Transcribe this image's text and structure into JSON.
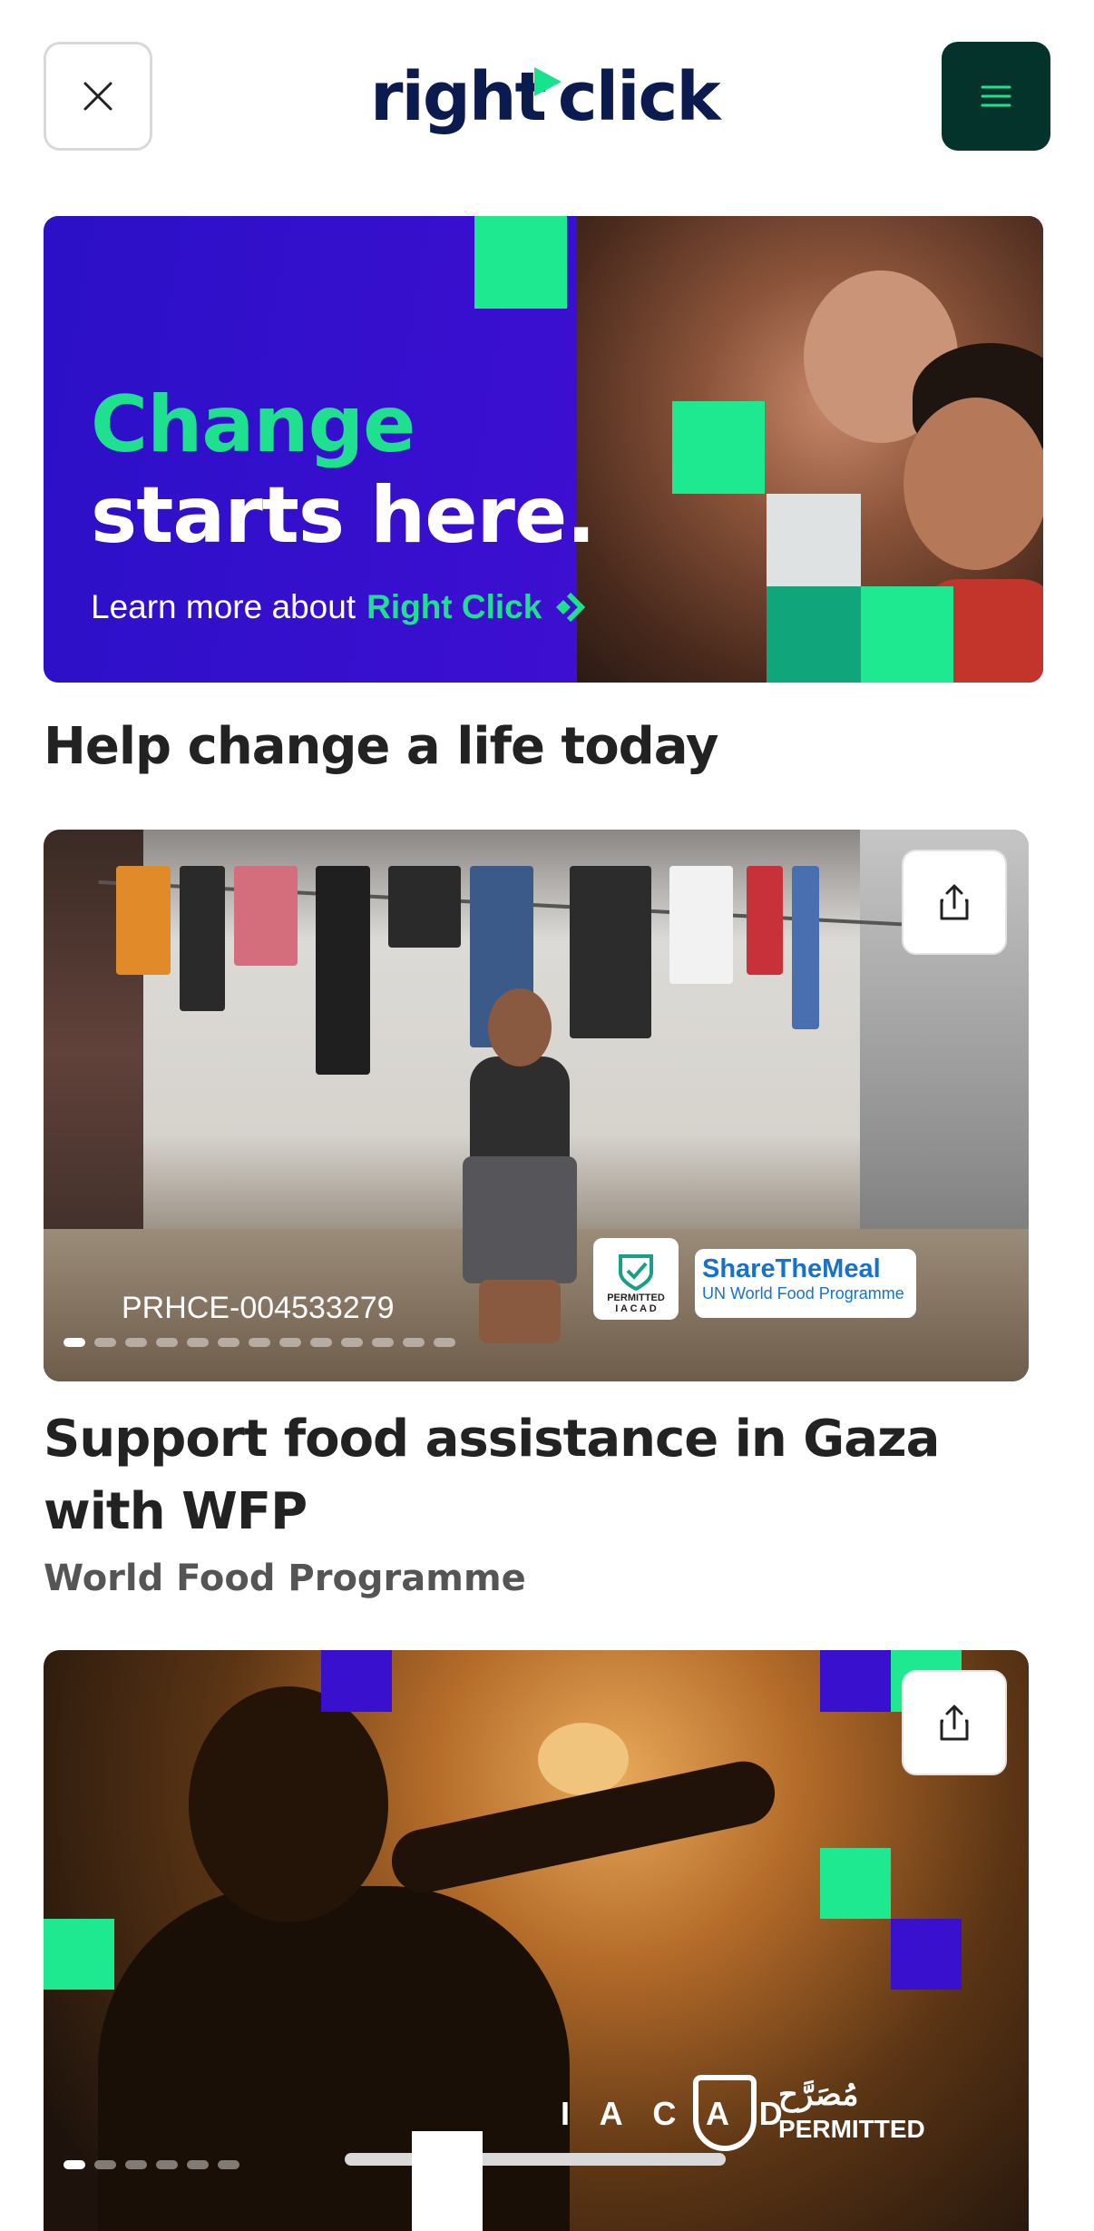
{
  "header": {
    "logo_text": "right",
    "logo_text2": "click",
    "close_icon": "close-icon",
    "menu_icon": "hamburger-menu-icon",
    "menu_color": "#03332a"
  },
  "hero": {
    "title_line1": "Change",
    "title_line2": "starts here.",
    "cta_prefix": "Learn more about",
    "cta_brand": "Right Click",
    "accent": "#1ee08e",
    "background": "#3d0fd1"
  },
  "section": {
    "title": "Help change a life today"
  },
  "cards": [
    {
      "code": "PRHCE-004533279",
      "permit_label": "PERMITTED",
      "permit_sub": "I A C A D",
      "partner_title": "ShareTheMeal",
      "partner_sub": "UN World Food Programme",
      "title": "Support food assistance in Gaza with WFP",
      "organization": "World Food Programme",
      "slides_total": 13,
      "slide_active": 1
    },
    {
      "iacad_label": "I A C A D",
      "iacad_arabic": "مُصَرَّح",
      "iacad_permitted": "PERMITTED",
      "slides_total": 6,
      "slide_active": 1
    }
  ]
}
